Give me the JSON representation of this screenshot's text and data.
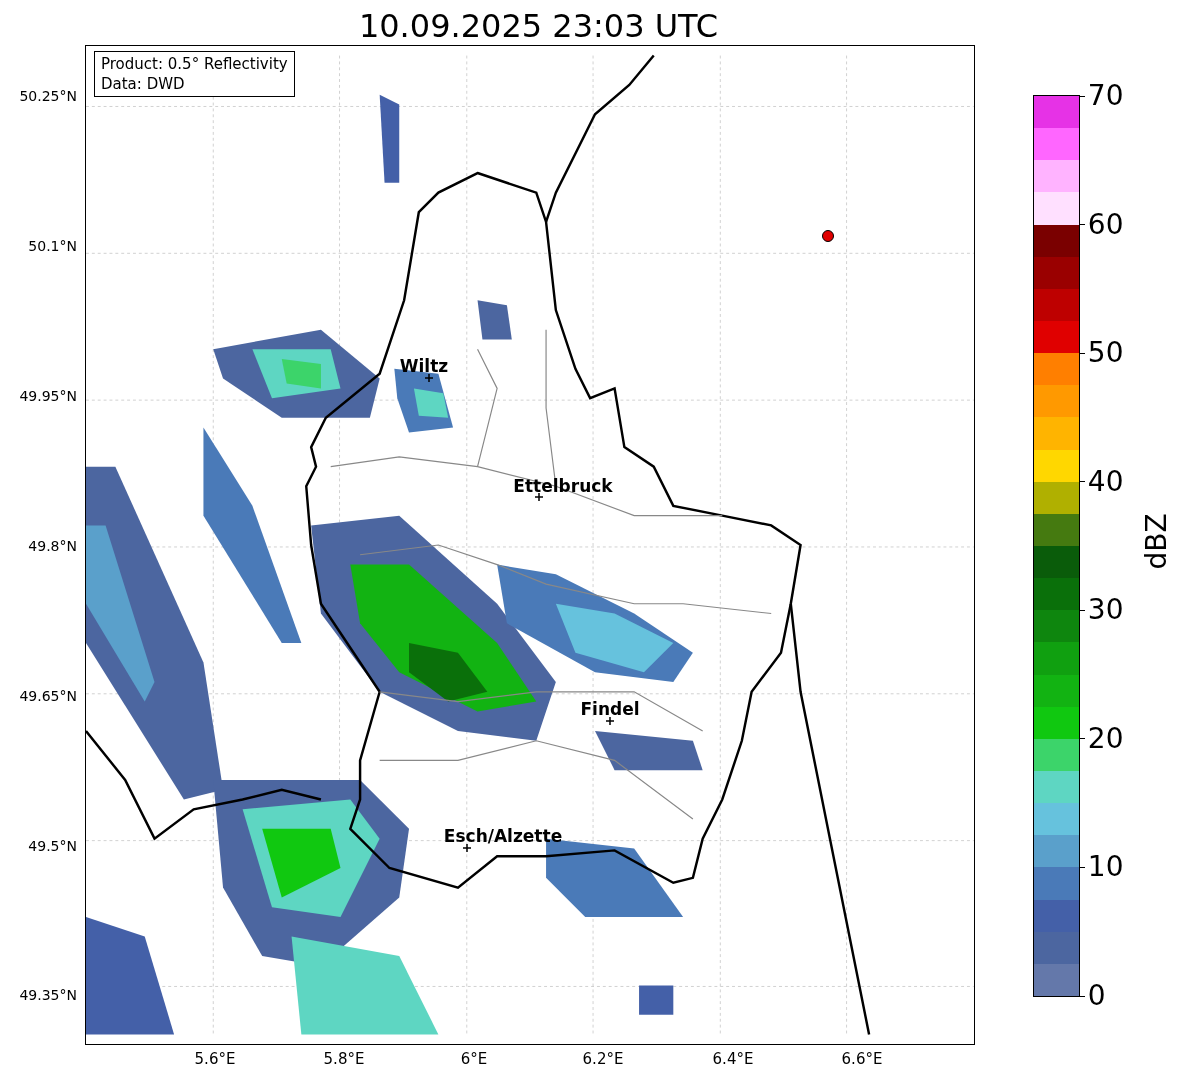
{
  "title": "10.09.2025 23:03 UTC",
  "info_box": [
    "Product: 0.5° Reflectivity",
    "Data: DWD"
  ],
  "map": {
    "y_ticks": [
      "50.25°N",
      "50.1°N",
      "49.95°N",
      "49.8°N",
      "49.65°N",
      "49.5°N",
      "49.35°N"
    ],
    "x_ticks": [
      "5.6°E",
      "5.8°E",
      "6°E",
      "6.2°E",
      "6.4°E",
      "6.6°E"
    ],
    "cities": [
      {
        "name": "Wiltz"
      },
      {
        "name": "Ettelbruck"
      },
      {
        "name": "Findel"
      },
      {
        "name": "Esch/Alzette"
      }
    ]
  },
  "colorbar": {
    "label": "dBZ",
    "ticks": [
      "70",
      "60",
      "50",
      "40",
      "30",
      "20",
      "10",
      "0"
    ],
    "bands": [
      {
        "color": "#e632e6"
      },
      {
        "color": "#ff66ff"
      },
      {
        "color": "#ffb3ff"
      },
      {
        "color": "#ffe0ff"
      },
      {
        "color": "#7a0000"
      },
      {
        "color": "#9a0000"
      },
      {
        "color": "#be0000"
      },
      {
        "color": "#e00000"
      },
      {
        "color": "#ff7f00"
      },
      {
        "color": "#ff9900"
      },
      {
        "color": "#ffb400"
      },
      {
        "color": "#ffd700"
      },
      {
        "color": "#b0b000"
      },
      {
        "color": "#457a10"
      },
      {
        "color": "#0a5c0a"
      },
      {
        "color": "#0a700a"
      },
      {
        "color": "#0e860e"
      },
      {
        "color": "#10a010"
      },
      {
        "color": "#12b312"
      },
      {
        "color": "#10c810"
      },
      {
        "color": "#3cd46a"
      },
      {
        "color": "#5ed6c2"
      },
      {
        "color": "#66c2dd"
      },
      {
        "color": "#5aa0cb"
      },
      {
        "color": "#4a7ab8"
      },
      {
        "color": "#4460a8"
      },
      {
        "color": "#4c66a0"
      },
      {
        "color": "#6478aa"
      }
    ]
  }
}
